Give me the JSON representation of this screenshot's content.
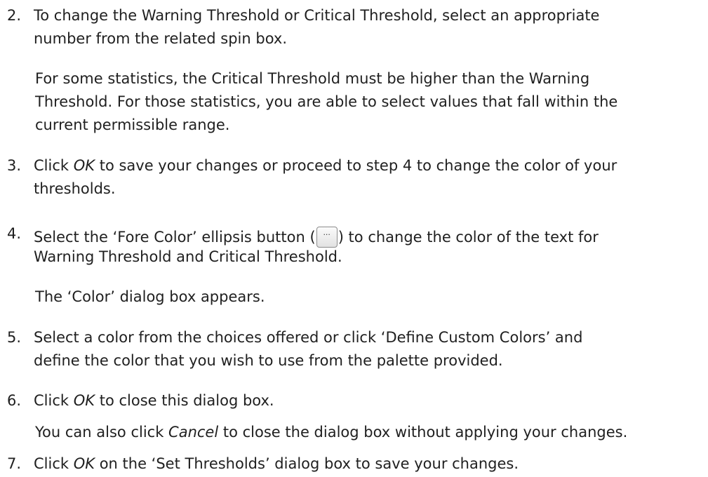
{
  "steps": [
    {
      "number": "2.",
      "lines": [
        "To change the Warning Threshold or Critical Threshold, select an appropriate",
        "number from the related spin box."
      ],
      "note_lines": [
        "For some statistics, the Critical Threshold must be higher than the Warning",
        "Threshold. For those statistics, you are able to select values that fall within the",
        "current permissible range."
      ]
    },
    {
      "number": "3.",
      "line1_pre": "Click ",
      "line1_em": "OK",
      "line1_post": " to save your changes or proceed to step 4 to change the color of your",
      "line2": "thresholds."
    },
    {
      "number": "4.",
      "line1_pre": "Select the ‘Fore Color’ ellipsis button (",
      "line1_post": ") to change the color of the text for",
      "line2": "Warning Threshold and Critical Threshold.",
      "note": "The ‘Color’ dialog box appears."
    },
    {
      "number": "5.",
      "lines": [
        "Select a color from the choices offered or click ‘Define Custom Colors’ and",
        "define the color that you wish to use from the palette provided."
      ]
    },
    {
      "number": "6.",
      "line1_pre": "Click ",
      "line1_em": "OK",
      "line1_post": " to close this dialog box.",
      "note_pre": "You can also click ",
      "note_em": "Cancel",
      "note_post": " to close the dialog box without applying your changes."
    },
    {
      "number": "7.",
      "line1_pre": "Click ",
      "line1_em": "OK",
      "line1_post": " on the ‘Set Thresholds’ dialog box to save your changes."
    }
  ],
  "icons": {
    "ellipsis_button": "ellipsis-button-icon"
  },
  "colors": {
    "text": "#1f1f1f",
    "background": "#ffffff"
  }
}
